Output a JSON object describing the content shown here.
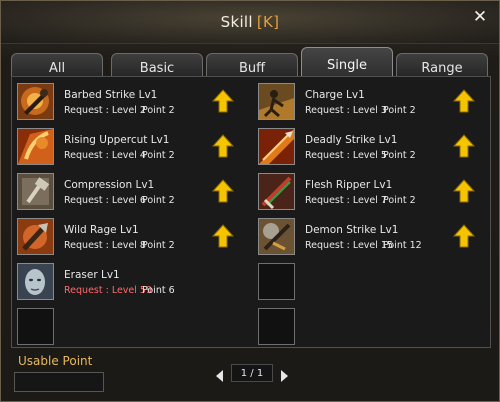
{
  "window": {
    "title": "Skill",
    "hotkey": "[K]"
  },
  "tabs": [
    {
      "label": "All",
      "active": false
    },
    {
      "label": "Basic",
      "active": false
    },
    {
      "label": "Buff",
      "active": false
    },
    {
      "label": "Single",
      "active": true
    },
    {
      "label": "Range",
      "active": false
    }
  ],
  "skills_left": [
    {
      "name": "Barbed Strike Lv1",
      "request": "Request : Level  2",
      "point": "Point  2",
      "icon": "barbed-strike-icon"
    },
    {
      "name": "Rising Uppercut Lv1",
      "request": "Request : Level  4",
      "point": "Point  2",
      "icon": "rising-uppercut-icon"
    },
    {
      "name": "Compression Lv1",
      "request": "Request : Level  6",
      "point": "Point  2",
      "icon": "compression-icon"
    },
    {
      "name": "Wild Rage Lv1",
      "request": "Request : Level  8",
      "point": "Point  2",
      "icon": "wild-rage-icon"
    },
    {
      "name": "Eraser Lv1",
      "request": "Request : Level 59",
      "point": "Point  6",
      "icon": "eraser-icon"
    }
  ],
  "skills_right": [
    {
      "name": "Charge Lv1",
      "request": "Request : Level  3",
      "point": "Point  2",
      "icon": "charge-icon"
    },
    {
      "name": "Deadly Strike Lv1",
      "request": "Request : Level  5",
      "point": "Point  2",
      "icon": "deadly-strike-icon"
    },
    {
      "name": "Flesh Ripper Lv1",
      "request": "Request : Level  7",
      "point": "Point  2",
      "icon": "flesh-ripper-icon"
    },
    {
      "name": "Demon Strike Lv1",
      "request": "Request : Level 15",
      "point": "Point 12",
      "icon": "demon-strike-icon"
    }
  ],
  "footer": {
    "usable_point_label": "Usable Point",
    "usable_point_value": "",
    "page": "1 / 1"
  },
  "colors": {
    "upgrade_arrow": "#f5c400",
    "locked_request": "#ff6a6a",
    "usable_label": "#e8b85a"
  }
}
